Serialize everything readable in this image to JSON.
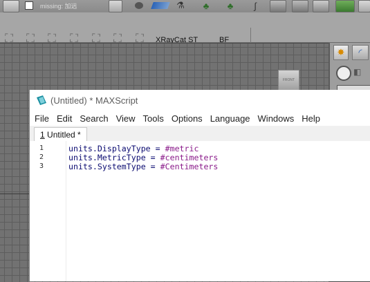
{
  "topbar": {
    "missing_text": "missing: 加远"
  },
  "toolbar2": {
    "label1": "XRayCat ST",
    "label2": "BF"
  },
  "viewport": {
    "cube_label": "FRONT"
  },
  "editor": {
    "title": "(Untitled) * MAXScript",
    "menu": [
      "File",
      "Edit",
      "Search",
      "View",
      "Tools",
      "Options",
      "Language",
      "Windows",
      "Help"
    ],
    "tab": {
      "number": "1",
      "label": " Untitled *"
    },
    "lines": [
      {
        "number": "1",
        "prop": "units.DisplayType = ",
        "value": "#metric"
      },
      {
        "number": "2",
        "prop": "units.MetricType = ",
        "value": "#centimeters"
      },
      {
        "number": "3",
        "prop": "units.SystemType = ",
        "value": "#Centimeters"
      }
    ]
  },
  "colors": {
    "code_property": "#0a0a70",
    "code_literal": "#8a1a8a",
    "app_icon_teal": "#1a8fa0"
  }
}
